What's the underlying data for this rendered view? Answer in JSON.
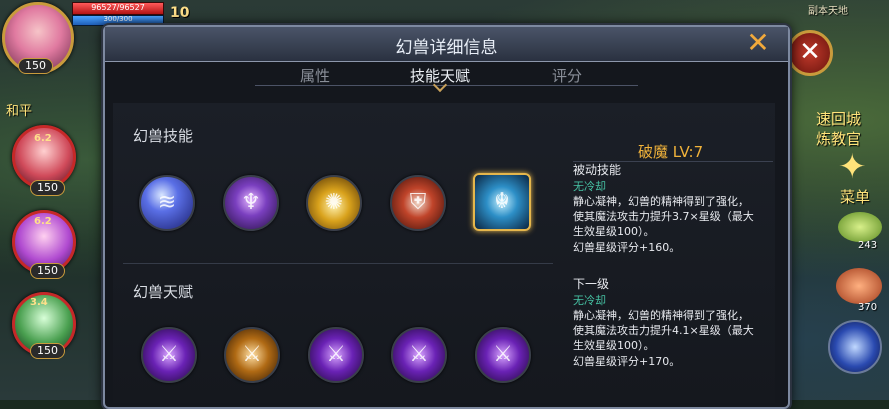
{
  "hud": {
    "player_level": "150",
    "hp_text": "96527/96527",
    "mp_text": "300/300",
    "hp_fraction": 1.0,
    "mp_fraction": 1.0,
    "side_number": "10",
    "party": [
      {
        "level": "150",
        "num": "6.2"
      },
      {
        "level": "150",
        "num": "6.2"
      },
      {
        "level": "150",
        "num": "3.4"
      }
    ],
    "left_tag": "和平",
    "right_labels": {
      "top": "副本天地",
      "city": "速回城",
      "trainer": "炼教官",
      "menu": "菜单",
      "count1": "243",
      "count2": "370"
    }
  },
  "dialog": {
    "title": "幻兽详细信息",
    "close_label": "✕",
    "tabs": [
      {
        "label": "属性",
        "active": false
      },
      {
        "label": "技能天赋",
        "active": true
      },
      {
        "label": "评分",
        "active": false
      }
    ],
    "skills_label": "幻兽技能",
    "talents_label": "幻兽天赋",
    "skill_icons": [
      {
        "name": "blue-slash-skill-icon",
        "glyph": "≋"
      },
      {
        "name": "purple-figure-skill-icon",
        "glyph": "♆"
      },
      {
        "name": "gold-burst-skill-icon",
        "glyph": "✺"
      },
      {
        "name": "red-shield-skill-icon",
        "glyph": "⛨"
      },
      {
        "name": "cyan-demon-skill-icon",
        "glyph": "☬"
      }
    ],
    "talent_icons": [
      {
        "name": "violet-blade-talent-icon",
        "glyph": "⚔"
      },
      {
        "name": "orange-blade-talent-icon",
        "glyph": "⚔"
      },
      {
        "name": "violet-blade-talent-icon-2",
        "glyph": "⚔"
      },
      {
        "name": "violet-blade-talent-icon-3",
        "glyph": "⚔"
      },
      {
        "name": "violet-blade-talent-icon-4",
        "glyph": "⚔"
      }
    ],
    "info": {
      "skill_name": "破魔 LV:7",
      "current_type": "被动技能",
      "current_cd": "无冷却",
      "current_desc_1": "静心凝神，幻兽的精神得到了强化，",
      "current_desc_2": "使其魔法攻击力提升3.7×星级（最大",
      "current_desc_3": "生效星级100）。",
      "current_score": "幻兽星级评分+160。",
      "next_label": "下一级",
      "next_cd": "无冷却",
      "next_desc_1": "静心凝神，幻兽的精神得到了强化，",
      "next_desc_2": "使其魔法攻击力提升4.1×星级（最大",
      "next_desc_3": "生效星级100）。",
      "next_score": "幻兽星级评分+170。"
    }
  }
}
